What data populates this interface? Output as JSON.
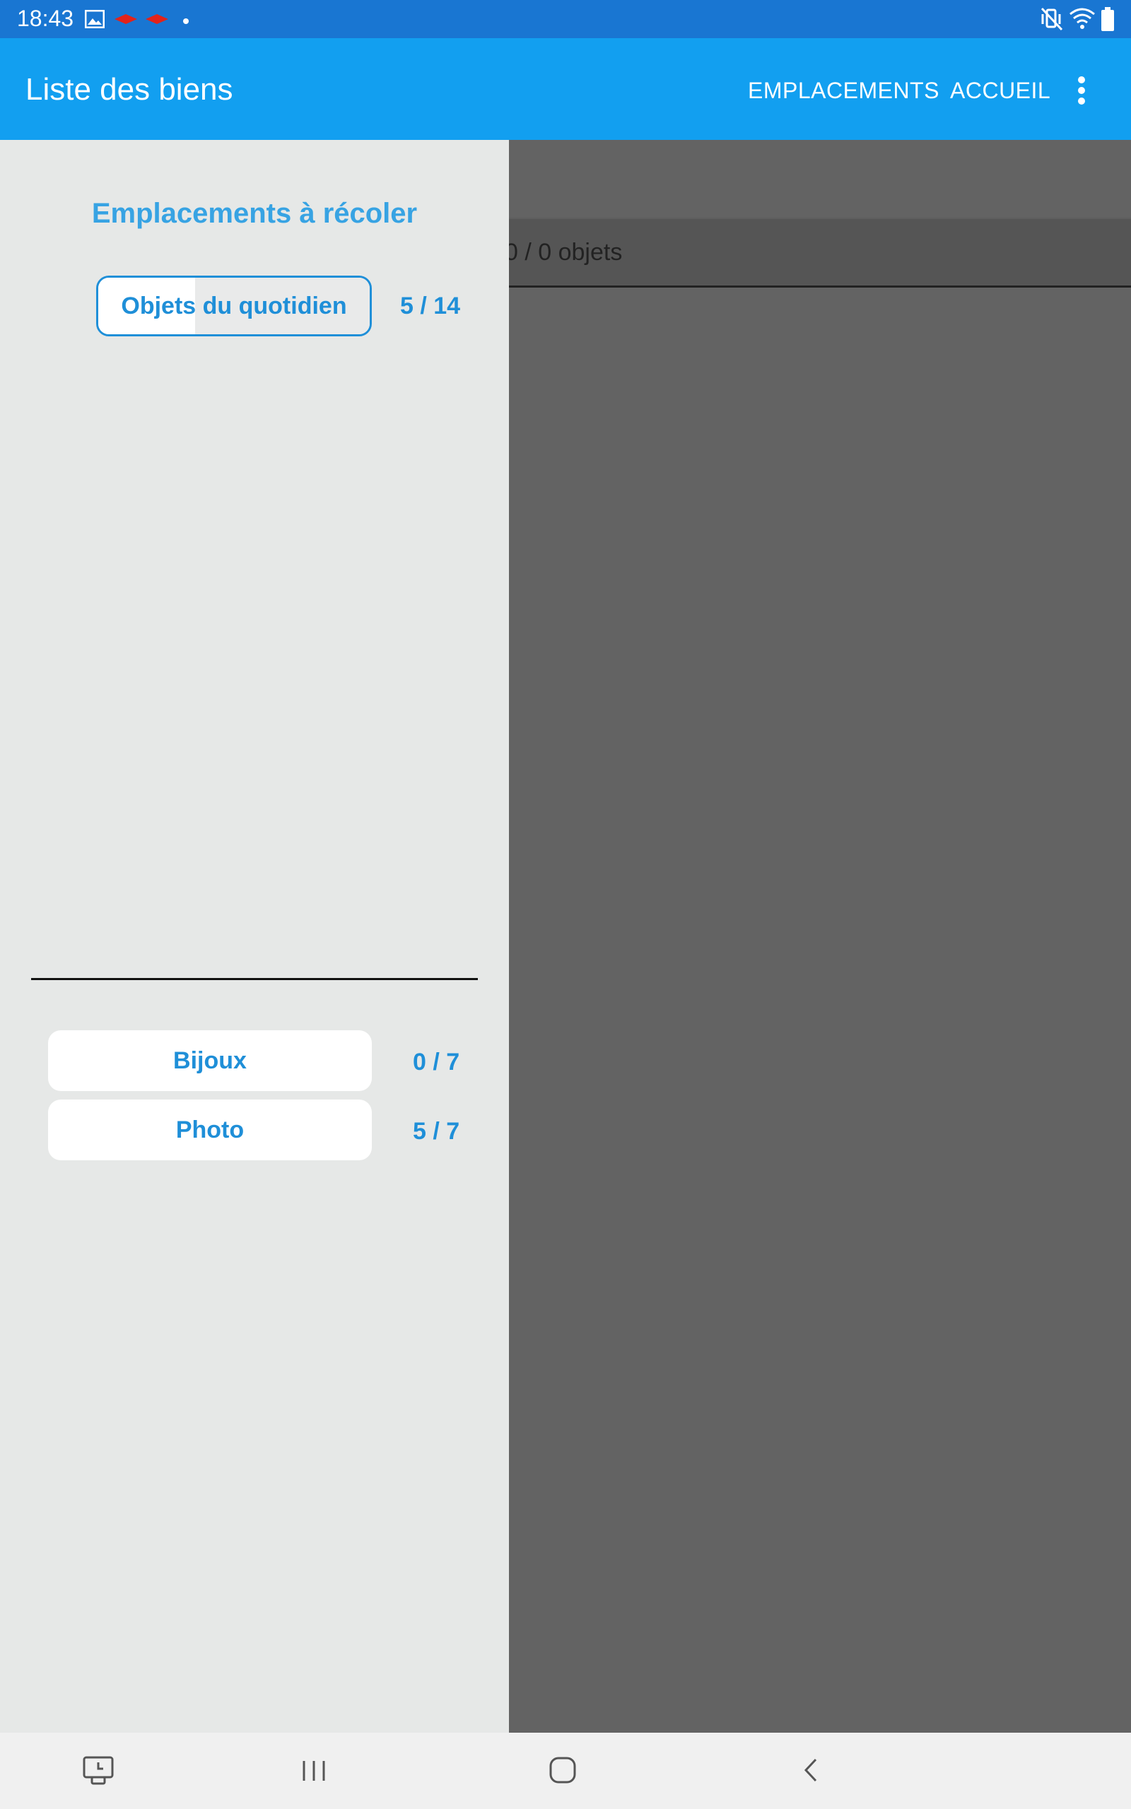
{
  "status_bar": {
    "time": "18:43",
    "icons_left": [
      "image-icon",
      "notification-icon",
      "notification-icon",
      "dot-icon"
    ],
    "icons_right": [
      "mute-vibrate-icon",
      "wifi-icon",
      "battery-icon"
    ]
  },
  "app_bar": {
    "title": "Liste des biens",
    "actions": [
      "EMPLACEMENTS",
      "ACCUEIL"
    ],
    "overflow_icon": "more-vert-icon"
  },
  "background": {
    "object_count": "0 / 0 objets"
  },
  "drawer": {
    "title": "Emplacements à récoler",
    "current_location": {
      "label": "Objets du quotidien",
      "count": "5 / 14",
      "progress": 0.357
    },
    "locations": [
      {
        "label": "Bijoux",
        "count": "0 / 7"
      },
      {
        "label": "Photo",
        "count": "5 / 7"
      }
    ]
  },
  "nav_bar": {
    "buttons": [
      "screen-recorder-icon",
      "recents-icon",
      "home-icon",
      "back-icon"
    ]
  },
  "colors": {
    "status_bar": "#1976d2",
    "app_bar": "#129ff0",
    "accent": "#1f8fd8",
    "drawer_bg": "#e6e8e7",
    "scrim": "#636363"
  }
}
